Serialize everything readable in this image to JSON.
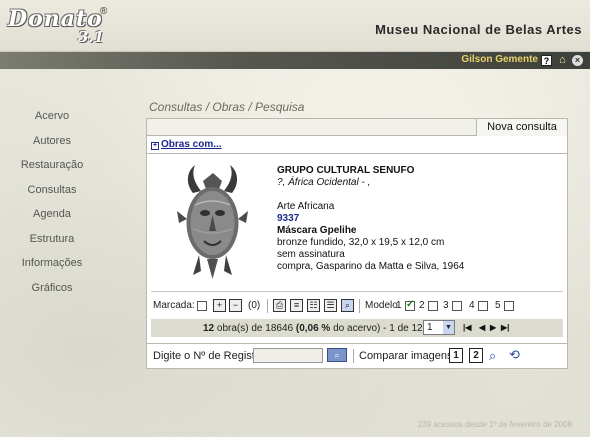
{
  "app": {
    "logo_word": "Donato",
    "logo_version": "3.1",
    "logo_reg": "®",
    "museum_title": "Museu Nacional de Belas Artes"
  },
  "userbar": {
    "user_name": "Gilson Gemente",
    "icons": [
      "help-icon",
      "home-icon",
      "close-icon"
    ]
  },
  "sidebar": {
    "items": [
      {
        "label": "Acervo"
      },
      {
        "label": "Autores"
      },
      {
        "label": "Restauração"
      },
      {
        "label": "Consultas"
      },
      {
        "label": "Agenda"
      },
      {
        "label": "Estrutura"
      },
      {
        "label": "Informações"
      },
      {
        "label": "Gráficos"
      }
    ]
  },
  "breadcrumb": "Consultas / Obras / Pesquisa",
  "panel": {
    "nova_consulta": "Nova consulta",
    "obras_com": "Obras com...",
    "record": {
      "grupo": "GRUPO CULTURAL SENUFO",
      "local": "?, África Ocidental - ,",
      "categoria": "Arte Africana",
      "numero": "9337",
      "titulo": "Máscara Gpelihe",
      "material": "bronze fundido, 32,0 x 19,5 x 12,0 cm",
      "assinatura": "sem assinatura",
      "aquisicao": "compra, Gasparino da Matta e Silva, 1964"
    },
    "toolbar": {
      "marcada_label": "Marcada:",
      "count": "(0)",
      "modelo_label": "Modelo",
      "modelos": [
        "1",
        "2",
        "3",
        "4",
        "5"
      ],
      "modelo_selected": "2"
    },
    "pagination": {
      "obras": "12",
      "obras_text": "obra(s) de 18646",
      "percent": "(0,06 %",
      "percent_tail": "do acervo) - 1 de 12",
      "page_value": "1"
    },
    "bottom": {
      "registro_label": "Digite o Nº de Registro:",
      "registro_value": "",
      "comparar_label": "Comparar imagens:"
    }
  },
  "footer": "239 acessos desde 1º de fevereiro de 2008"
}
